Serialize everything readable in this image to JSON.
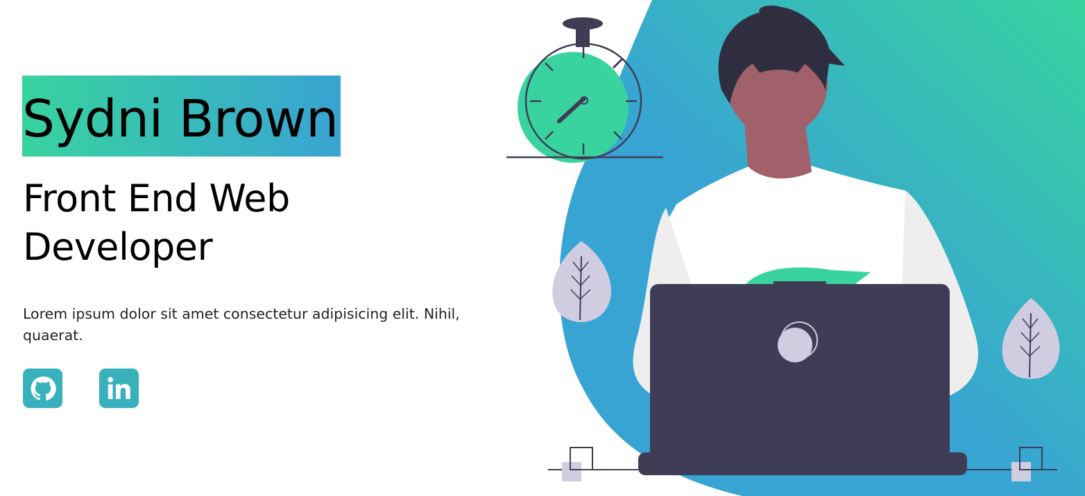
{
  "hero": {
    "name": "Sydni Brown",
    "role": "Front End Web Developer",
    "description": "Lorem ipsum dolor sit amet consectetur adipisicing elit. Nihil, quaerat."
  },
  "socials": [
    {
      "icon": "github-icon"
    },
    {
      "icon": "linkedin-icon"
    }
  ],
  "colors": {
    "gradient_start": "#38d39f",
    "gradient_end": "#38a4d3",
    "social_bg": "#38b1bd",
    "laptop": "#3f3d56",
    "skin": "#a0616a",
    "hair": "#2f2e41",
    "shirt": "#eeeeee",
    "leaf": "#d0cde1"
  }
}
